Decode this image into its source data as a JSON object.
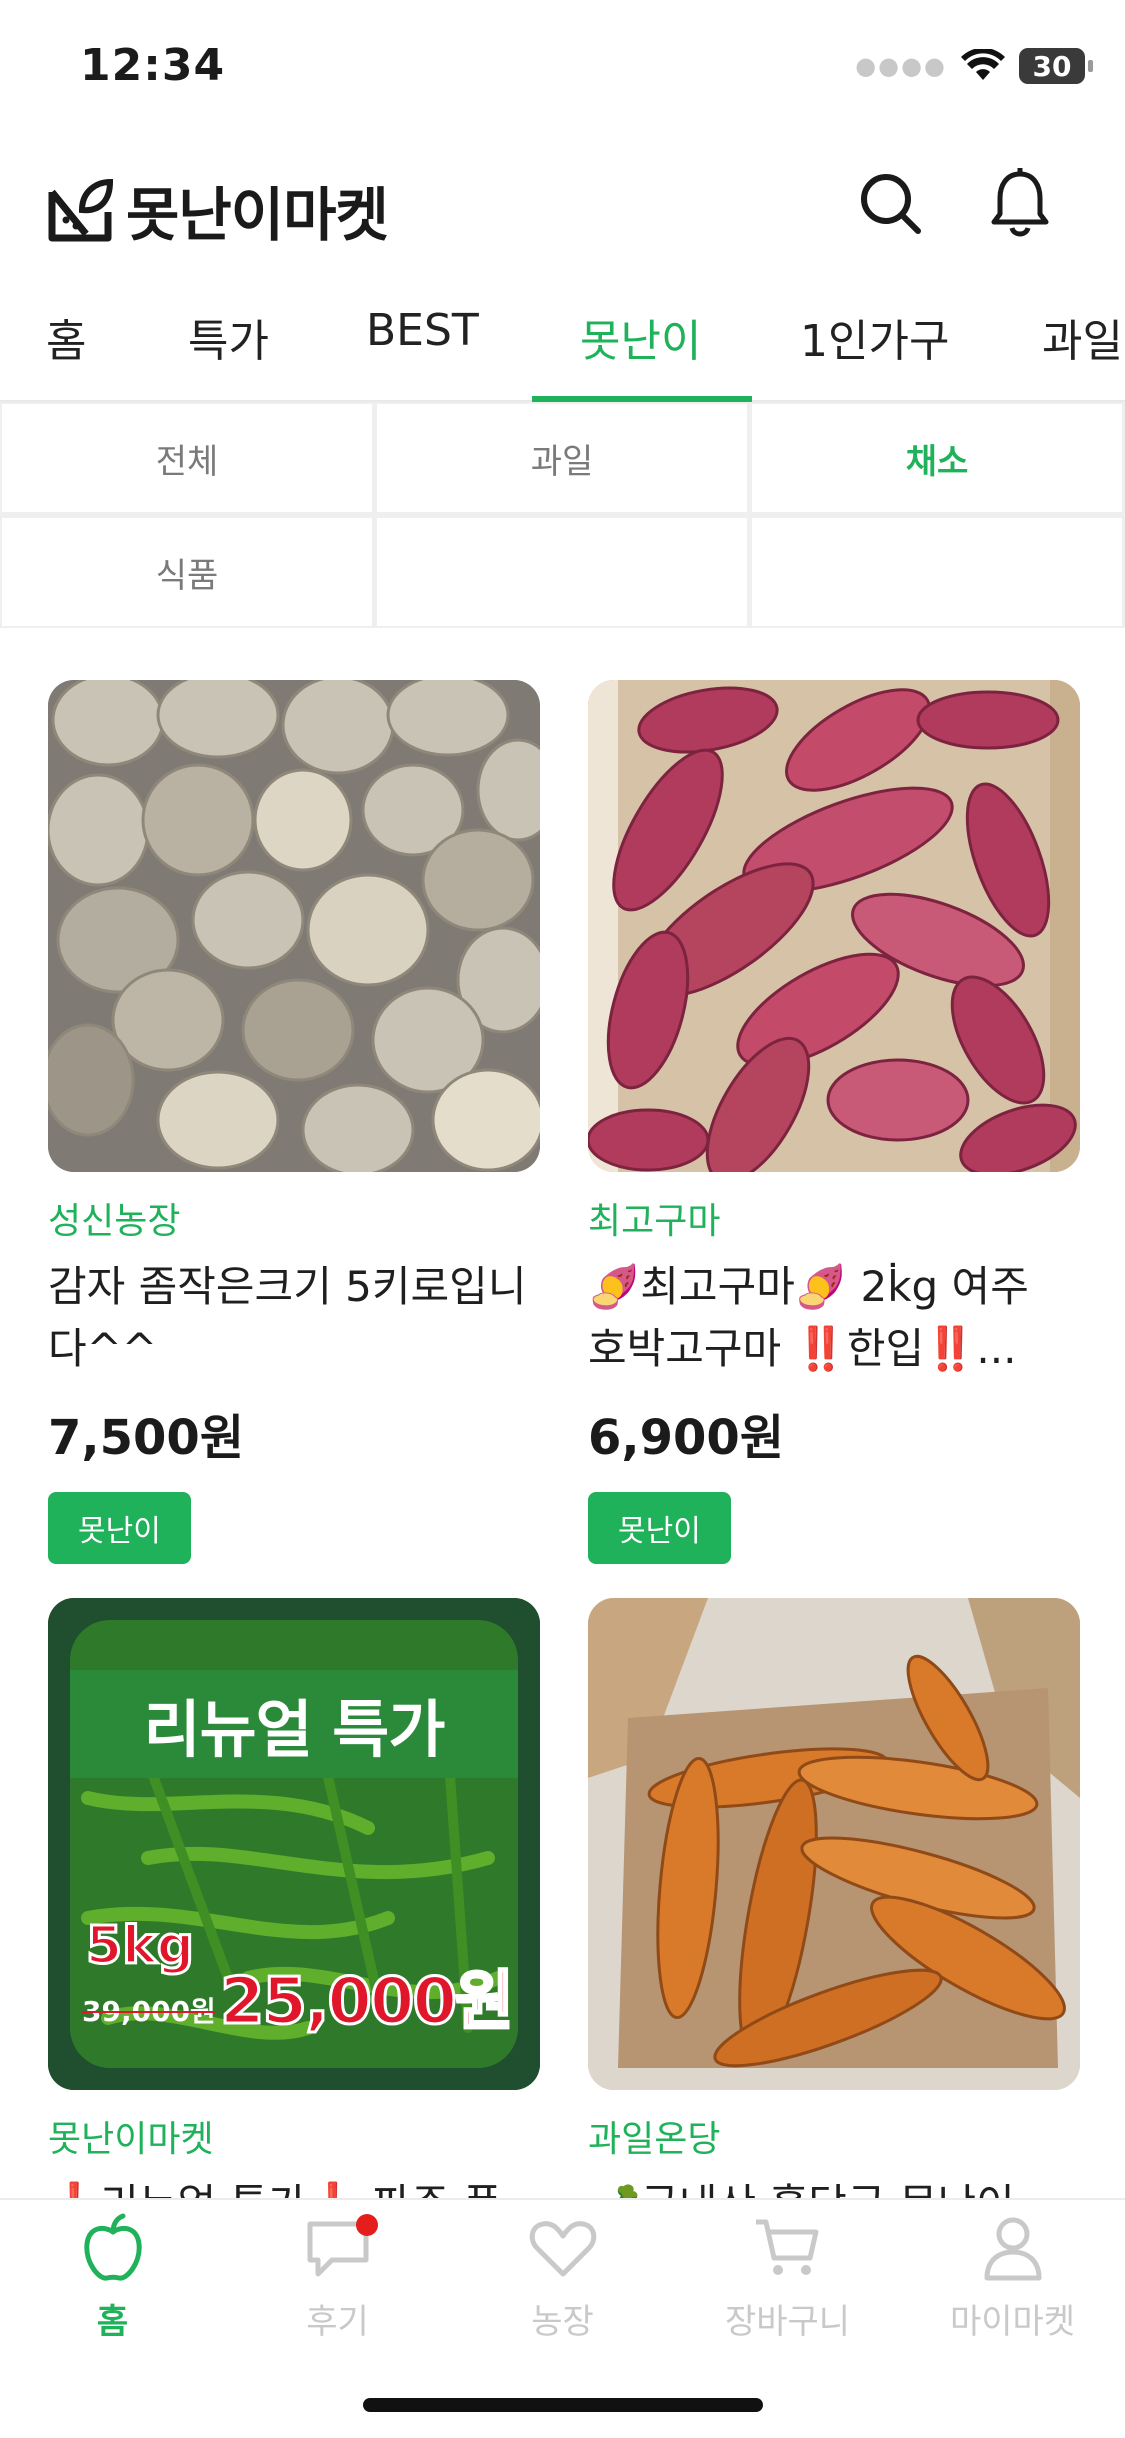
{
  "status_bar": {
    "time": "12:34",
    "battery": "30"
  },
  "app": {
    "title": "못난이마켓"
  },
  "tabs": [
    {
      "label": "홈",
      "active": false
    },
    {
      "label": "특가",
      "active": false
    },
    {
      "label": "BEST",
      "active": false
    },
    {
      "label": "못난이",
      "active": true
    },
    {
      "label": "1인가구",
      "active": false
    },
    {
      "label": "과일",
      "active": false
    }
  ],
  "subcategories": [
    {
      "label": "전체",
      "active": false
    },
    {
      "label": "과일",
      "active": false
    },
    {
      "label": "채소",
      "active": true
    },
    {
      "label": "식품",
      "active": false
    },
    {
      "label": "",
      "active": false
    },
    {
      "label": "",
      "active": false
    }
  ],
  "products": [
    {
      "farm": "성신농장",
      "name": "감자 좀작은크기 5키로입니다^^",
      "price": "7,500원",
      "badge": "못난이",
      "image": "potatoes"
    },
    {
      "farm": "최고구마",
      "name": "🍠최고구마🍠 2k̇g 여주 호박고구마 ‼️한입‼️...",
      "price": "6,900원",
      "badge": "못난이",
      "image": "sweet-potatoes"
    },
    {
      "farm": "못난이마켓",
      "name": "❗리뉴얼 특가❗ 파주 풋",
      "price": "",
      "badge": "",
      "image": "green-peppers",
      "promo": {
        "headline": "리뉴얼 특가",
        "weight": "5kg",
        "old_price": "39,000원",
        "new_price": "25,000원"
      }
    },
    {
      "farm": "과일온당",
      "name": "🥕국내산 흙당근 못난이",
      "price": "",
      "badge": "",
      "image": "carrots"
    }
  ],
  "bottom_nav": [
    {
      "label": "홈",
      "icon": "apple-icon",
      "active": true
    },
    {
      "label": "후기",
      "icon": "chat-bubble-icon",
      "active": false,
      "dot": true
    },
    {
      "label": "농장",
      "icon": "heart-icon",
      "active": false
    },
    {
      "label": "장바구니",
      "icon": "cart-icon",
      "active": false
    },
    {
      "label": "마이마켓",
      "icon": "person-icon",
      "active": false
    }
  ],
  "colors": {
    "accent": "#1fb25a",
    "text": "#1b1b1b",
    "muted": "#c9c9c9",
    "notification": "#e51d1d"
  }
}
